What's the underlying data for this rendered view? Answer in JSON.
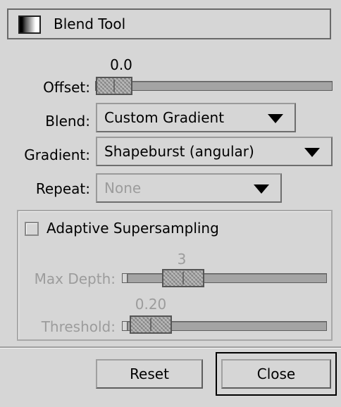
{
  "window": {
    "title": "Blend Tool",
    "icon": "gradient-icon"
  },
  "offset": {
    "label": "Offset:",
    "value": "0.0",
    "fraction": 0.0
  },
  "blend": {
    "label": "Blend:",
    "selected": "Custom Gradient"
  },
  "gradient": {
    "label": "Gradient:",
    "selected": "Shapeburst (angular)"
  },
  "repeat": {
    "label": "Repeat:",
    "selected": "None",
    "enabled": false
  },
  "supersampling": {
    "checkbox_label": "Adaptive Supersampling",
    "checked": false,
    "max_depth": {
      "label": "Max Depth:",
      "value": "3",
      "enabled": false
    },
    "threshold": {
      "label": "Threshold:",
      "value": "0.20",
      "enabled": false
    }
  },
  "buttons": {
    "reset": "Reset",
    "close": "Close"
  }
}
